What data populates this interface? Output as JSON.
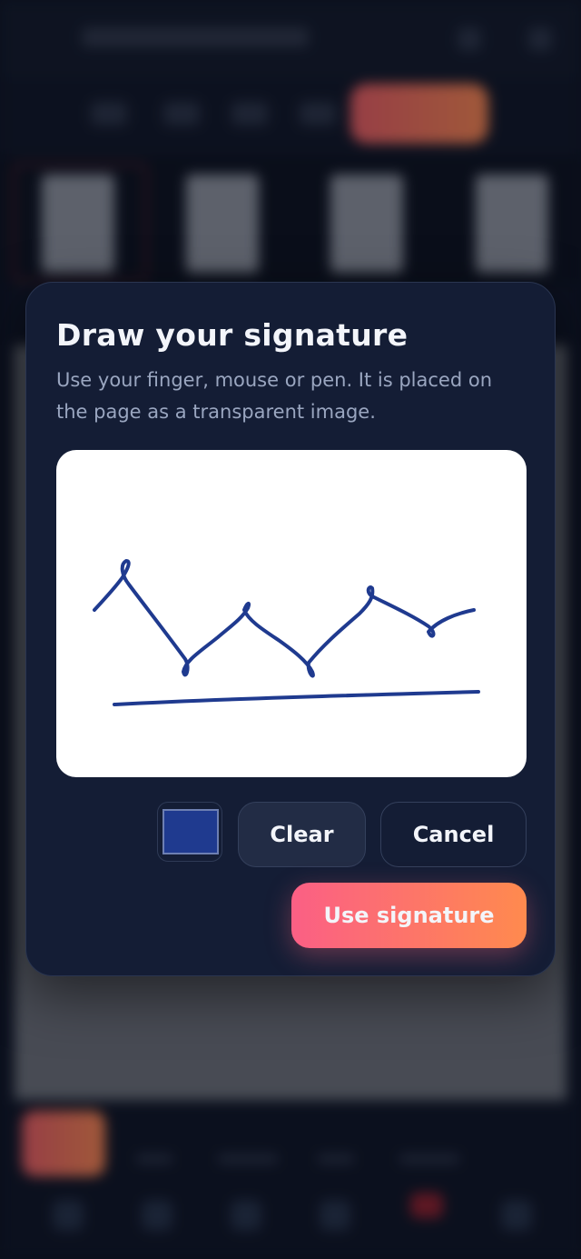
{
  "modal": {
    "title": "Draw your signature",
    "description": "Use your finger, mouse or pen. It is placed on the page as a transparent image.",
    "pen_color": "#1f3a8f",
    "buttons": {
      "clear": "Clear",
      "cancel": "Cancel",
      "use": "Use signature"
    }
  },
  "colors": {
    "accent_gradient_start": "#fb5f85",
    "accent_gradient_end": "#ff8a4e",
    "modal_bg": "#141d35"
  }
}
